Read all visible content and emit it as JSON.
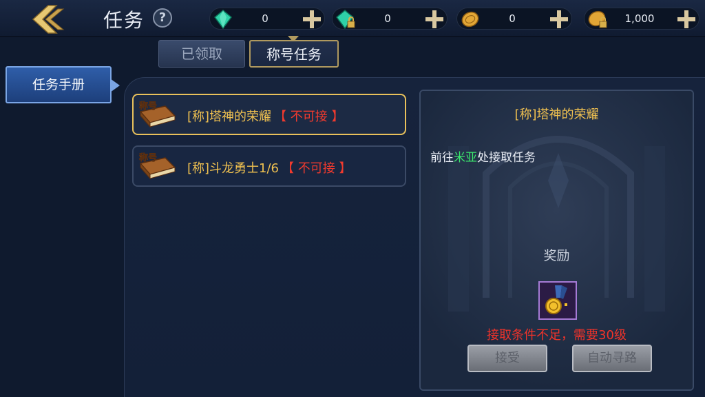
{
  "header": {
    "title": "任务",
    "help_label": "?"
  },
  "currencies": [
    {
      "name": "diamond",
      "icon": "diamond-icon",
      "value": "0"
    },
    {
      "name": "bound-diamond",
      "icon": "bound-diamond-icon",
      "value": "0"
    },
    {
      "name": "gold",
      "icon": "gold-coin-icon",
      "value": "0"
    },
    {
      "name": "bound-gold",
      "icon": "bound-gold-coin-icon",
      "value": "1,000"
    }
  ],
  "tabs": {
    "claimed": "已领取",
    "title_quests": "称号任务"
  },
  "sidebar": {
    "handbook": "任务手册"
  },
  "tasks": [
    {
      "book_label": "称号",
      "name": "[称]塔神的荣耀",
      "status": "【 不可接 】"
    },
    {
      "book_label": "称号",
      "name": "[称]斗龙勇士1/6",
      "status": "【 不可接 】"
    }
  ],
  "detail": {
    "title": "[称]塔神的荣耀",
    "desc_before": "前往",
    "desc_npc": "米亚",
    "desc_after": "处接取任务",
    "reward_label": "奖励",
    "warning": "接取条件不足，需要30级",
    "accept_button": "接受",
    "auto_path_button": "自动寻路"
  },
  "colors": {
    "accent_gold": "#f0c150",
    "status_red": "#f03a2e",
    "npc_green": "#3be86d",
    "side_blue": "#2f5ea9"
  }
}
